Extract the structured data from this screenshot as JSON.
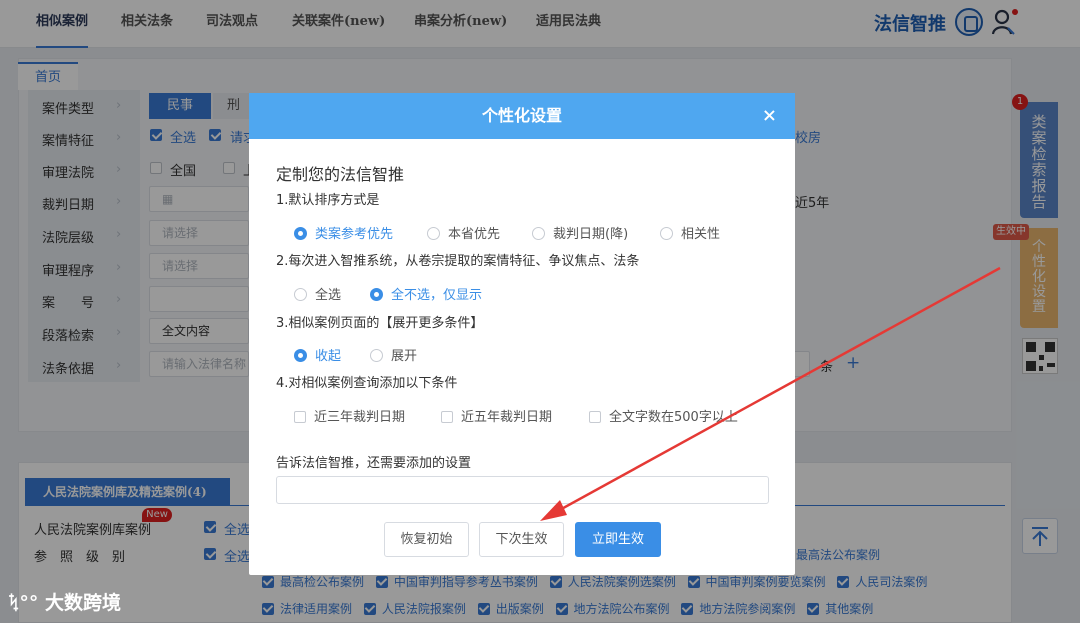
{
  "topnav": {
    "tabs": [
      "相似案例",
      "相关法条",
      "司法观点",
      "关联案件(new)",
      "串案分析(new)",
      "适用民法典"
    ],
    "brand": "法信智推"
  },
  "page": {
    "home_tab": "首页",
    "filter_labels": [
      "案件类型",
      "案情特征",
      "审理法院",
      "裁判日期",
      "法院层级",
      "审理程序",
      "案　　号",
      "段落检索",
      "法条依据"
    ],
    "case_type_active": "民事",
    "case_type_other": "刑事",
    "feature_all": "全选",
    "feature_first": "请求",
    "feature_right_fragment": "校房",
    "court_all": "全国",
    "court_second": "上",
    "date_right_fragment": "近5年",
    "level_placeholder": "请选择",
    "procedure_placeholder": "请选择",
    "paragraph_select": "全文内容",
    "law_placeholder": "请输入法律名称",
    "law_article_suffix": "条",
    "plus": "+"
  },
  "lower": {
    "tab_label": "人民法院案例库及精选案例(4)",
    "row1_label": "人民法院案例库案例",
    "new_badge": "New",
    "select_all": "全选",
    "row2_label": "参　照　级　别",
    "right_row2": "最高法公布案例",
    "row3": [
      "最高检公布案例",
      "中国审判指导参考丛书案例",
      "人民法院案例选案例",
      "中国审判案例要览案例",
      "人民司法案例"
    ],
    "row4": [
      "法律适用案例",
      "人民法院报案例",
      "出版案例",
      "地方法院公布案例",
      "地方法院参阅案例",
      "其他案例"
    ]
  },
  "side": {
    "report_label": "类案检索报告",
    "report_badge": "1",
    "settings_label": "个性化设置",
    "active_tag": "生效中"
  },
  "modal": {
    "title": "个性化设置",
    "close": "×",
    "heading": "定制您的法信智推",
    "q1": "1.默认排序方式是",
    "q1_options": [
      "类案参考优先",
      "本省优先",
      "裁判日期(降)",
      "相关性"
    ],
    "q1_selected": 0,
    "q2": "2.每次进入智推系统，从卷宗提取的案情特征、争议焦点、法条",
    "q2_options": [
      "全选",
      "全不选，仅显示"
    ],
    "q2_selected": 1,
    "q3": "3.相似案例页面的【展开更多条件】",
    "q3_options": [
      "收起",
      "展开"
    ],
    "q3_selected": 0,
    "q4": "4.对相似案例查询添加以下条件",
    "q4_options": [
      "近三年裁判日期",
      "近五年裁判日期",
      "全文字数在500字以上"
    ],
    "feedback_label": "告诉法信智推，还需要添加的设置",
    "feedback_value": "",
    "btn_reset": "恢复初始",
    "btn_next": "下次生效",
    "btn_now": "立即生效"
  },
  "watermark": "大数跨境",
  "colors": {
    "accent": "#3a8ee6",
    "header": "#4fa7f0",
    "annotation_arrow": "#e53935"
  }
}
